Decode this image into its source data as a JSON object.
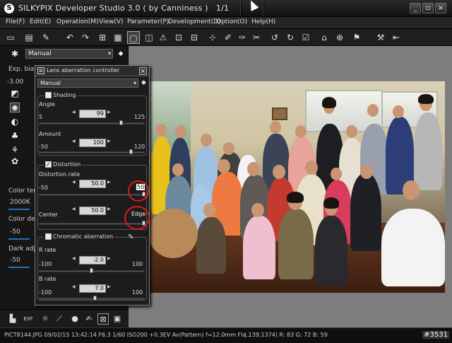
{
  "window": {
    "title": "SILKYPIX Developer Studio 3.0 ( by Canniness )",
    "page_counter": "1/1",
    "logo_glyph": "S"
  },
  "menu": [
    {
      "label": "File(F)"
    },
    {
      "label": "Edit(E)"
    },
    {
      "label": "Operation(M)"
    },
    {
      "label": "View(V)"
    },
    {
      "label": "Parameter(P)"
    },
    {
      "label": "Development(D)"
    },
    {
      "label": "Option(O)"
    },
    {
      "label": "Help(H)"
    }
  ],
  "left_panel": {
    "mode_select": "Manual",
    "exp_bias_label": "Exp. bias",
    "exp_bias_value": "-3.00",
    "color_temp_label": "Color tem",
    "color_temp_value": "2000K",
    "color_def_label": "Color def",
    "color_def_value": "-50",
    "dark_adj_label": "Dark adju",
    "dark_adj_value": "-50"
  },
  "lens_dialog": {
    "title": "Lens aberration controller",
    "preset": "Manual",
    "shading": {
      "label": "Shading",
      "checked": false,
      "angle": {
        "label": "Angle",
        "min": "5",
        "max": "125",
        "value": "99",
        "fraction": 0.78
      },
      "amount": {
        "label": "Amount",
        "min": "-50",
        "max": "120",
        "value": "100",
        "fraction": 0.88
      }
    },
    "distortion": {
      "label": "Distortion",
      "checked": true,
      "rate": {
        "label": "Distortion rate",
        "min": "-50",
        "max": "50",
        "value": "50.0",
        "fraction": 1.0,
        "annotation": "50"
      },
      "center": {
        "label": "Center",
        "value": "50.0",
        "fraction": 1.0,
        "annotation": "Edge"
      }
    },
    "chromatic": {
      "label": "Chromatic aberration",
      "checked": false,
      "r_rate": {
        "label": "R rate",
        "min": "-100",
        "max": "100",
        "value": "-2.0",
        "fraction": 0.49
      },
      "b_rate": {
        "label": "B rate",
        "min": "-100",
        "max": "100",
        "value": "7.0",
        "fraction": 0.53
      }
    }
  },
  "status": {
    "file_info": "PICT8144.JPG 09/02/15 13:42:14 F6.3 1/60 ISO200 +0.3EV Av(Pattern) f=12.0mm Fla...",
    "pixel_info": "( 139,1374)  R: 83  G: 72  B: 59",
    "badge": "#3531"
  },
  "colors": {
    "annotation_red": "#e01818",
    "slider_blue": "#2a6fb0"
  }
}
